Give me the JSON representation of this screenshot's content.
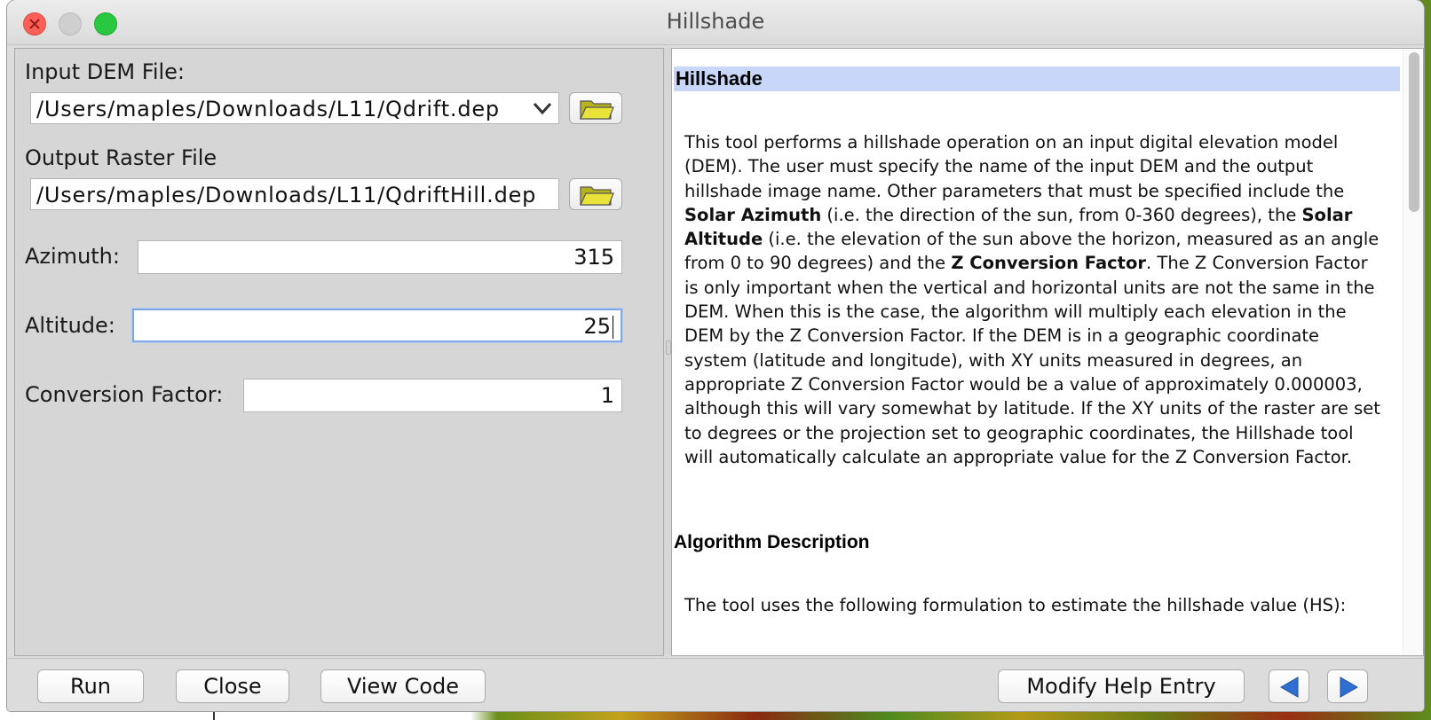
{
  "window": {
    "title": "Hillshade"
  },
  "form": {
    "input_dem": {
      "label": "Input DEM File:",
      "value": "/Users/maples/Downloads/L11/Qdrift.dep"
    },
    "output_raster": {
      "label": "Output Raster File",
      "value": "/Users/maples/Downloads/L11/QdriftHill.dep"
    },
    "azimuth": {
      "label": "Azimuth:",
      "value": "315"
    },
    "altitude": {
      "label": "Altitude:",
      "value": "25"
    },
    "conversion_factor": {
      "label": "Conversion Factor:",
      "value": "1"
    }
  },
  "help": {
    "heading": "Hillshade",
    "p1_a": "This tool performs a hillshade operation on an input digital elevation model (DEM). The user must specify the name of the input DEM and the output hillshade image name. Other parameters that must be specified include the ",
    "solar_azimuth": "Solar Azimuth",
    "p1_b": " (i.e. the direction of the sun, from 0-360 degrees), the ",
    "solar_altitude": "Solar Altitude",
    "p1_c": " (i.e. the elevation of the sun above the horizon, measured as an angle from 0 to 90 degrees) and the ",
    "z_factor": "Z Conversion Factor",
    "p1_d": ". The Z Conversion Factor is only important when the vertical and horizontal units are not the same in the DEM. When this is the case, the algorithm will multiply each elevation in the DEM by the Z Conversion Factor. If the DEM is in a geographic coordinate system (latitude and longitude), with XY units measured in degrees, an appropriate Z Conversion Factor would be a value of approximately 0.000003, although this will vary somewhat by latitude. If the XY units of the raster are set to degrees or the projection set to geographic coordinates, the Hillshade tool will automatically calculate an appropriate value for the Z Conversion Factor.",
    "heading2": "Algorithm Description",
    "p2": "The tool uses the following formulation to estimate the hillshade value (HS):"
  },
  "buttons": {
    "run": "Run",
    "close": "Close",
    "view_code": "View Code",
    "modify_help": "Modify Help Entry"
  },
  "icons": {
    "folder": "folder-open-icon",
    "dropdown": "chevron-down-icon",
    "back": "arrow-left-icon",
    "forward": "arrow-right-icon"
  },
  "colors": {
    "help_heading_bg": "#c8d6f9",
    "focus_ring": "#7fa7e6",
    "nav_arrow": "#2f6fd0",
    "folder": "#d8d32a"
  }
}
